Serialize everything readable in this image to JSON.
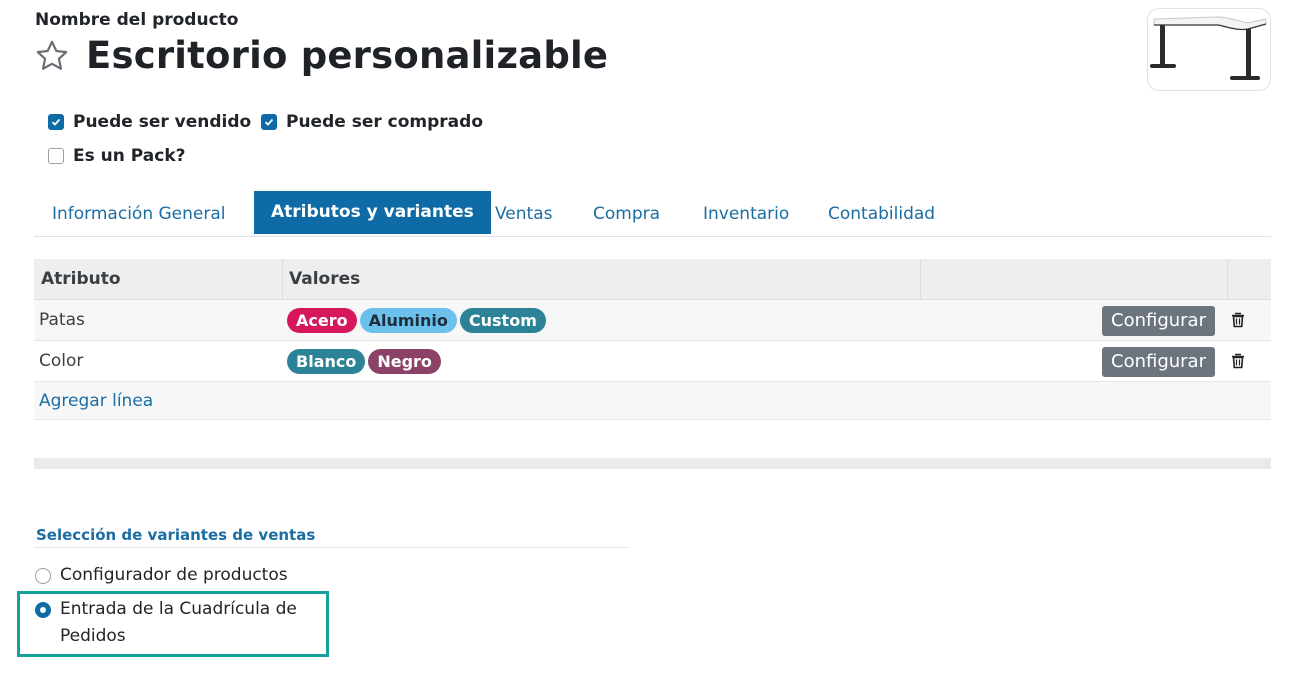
{
  "header": {
    "product_label": "Nombre del producto",
    "title": "Escritorio personalizable",
    "star_icon": "star-outline-icon",
    "image_icon": "desk-image"
  },
  "checkboxes": [
    {
      "label": "Puede ser vendido",
      "checked": true
    },
    {
      "label": "Puede ser comprado",
      "checked": true
    },
    {
      "label": "Es un Pack?",
      "checked": false
    }
  ],
  "tabs": [
    {
      "label": "Información General",
      "active": false
    },
    {
      "label": "Atributos y variantes",
      "active": true
    },
    {
      "label": "Ventas",
      "active": false
    },
    {
      "label": "Compra",
      "active": false
    },
    {
      "label": "Inventario",
      "active": false
    },
    {
      "label": "Contabilidad",
      "active": false
    }
  ],
  "table": {
    "columns": [
      "Atributo",
      "Valores"
    ],
    "rows": [
      {
        "attribute": "Patas",
        "values": [
          {
            "label": "Acero",
            "color": "#d6175b"
          },
          {
            "label": "Aluminio",
            "color": "#6cc1ec"
          },
          {
            "label": "Custom",
            "color": "#2c8397"
          }
        ],
        "button": "Configurar"
      },
      {
        "attribute": "Color",
        "values": [
          {
            "label": "Blanco",
            "color": "#2c8397"
          },
          {
            "label": "Negro",
            "color": "#8b4266"
          }
        ],
        "button": "Configurar"
      }
    ],
    "add_line": "Agregar línea"
  },
  "variants_section": {
    "title": "Selección de variantes de ventas",
    "options": [
      {
        "label": "Configurador de productos",
        "selected": false
      },
      {
        "label": "Entrada de la Cuadrícula de Pedidos",
        "selected": true
      }
    ]
  },
  "colors": {
    "accent": "#0f6ba6",
    "link": "#1a6ea3",
    "highlight": "#12a29b"
  }
}
